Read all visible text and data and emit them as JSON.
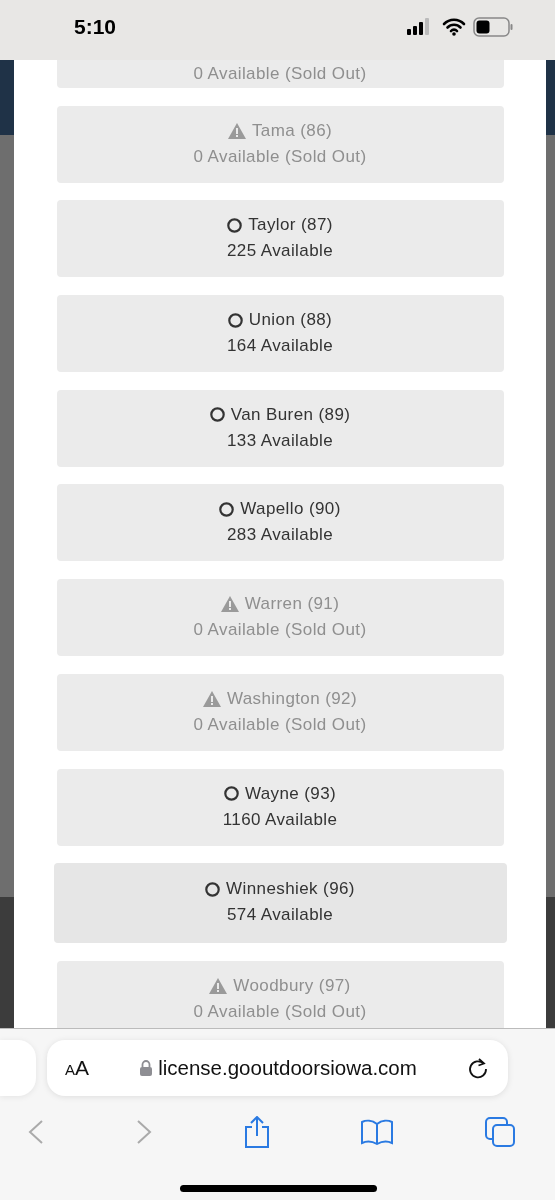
{
  "status_bar": {
    "time": "5:10"
  },
  "counties": [
    {
      "availability": "0 Available (Sold Out)",
      "sold_out": true,
      "selected": false
    },
    {
      "name": "Tama (86)",
      "availability": "0 Available (Sold Out)",
      "sold_out": true,
      "selected": false
    },
    {
      "name": "Taylor (87)",
      "availability": "225 Available",
      "sold_out": false,
      "selected": false
    },
    {
      "name": "Union (88)",
      "availability": "164 Available",
      "sold_out": false,
      "selected": false
    },
    {
      "name": "Van Buren (89)",
      "availability": "133 Available",
      "sold_out": false,
      "selected": false
    },
    {
      "name": "Wapello (90)",
      "availability": "283 Available",
      "sold_out": false,
      "selected": false
    },
    {
      "name": "Warren (91)",
      "availability": "0 Available (Sold Out)",
      "sold_out": true,
      "selected": false
    },
    {
      "name": "Washington (92)",
      "availability": "0 Available (Sold Out)",
      "sold_out": true,
      "selected": false
    },
    {
      "name": "Wayne (93)",
      "availability": "1160 Available",
      "sold_out": false,
      "selected": false
    },
    {
      "name": "Winneshiek (96)",
      "availability": "574 Available",
      "sold_out": false,
      "selected": true
    },
    {
      "name": "Woodbury (97)",
      "availability": "0 Available (Sold Out)",
      "sold_out": true,
      "selected": false
    }
  ],
  "browser": {
    "text_size_button": "AA",
    "url": "license.gooutdoorsiowa.com"
  }
}
